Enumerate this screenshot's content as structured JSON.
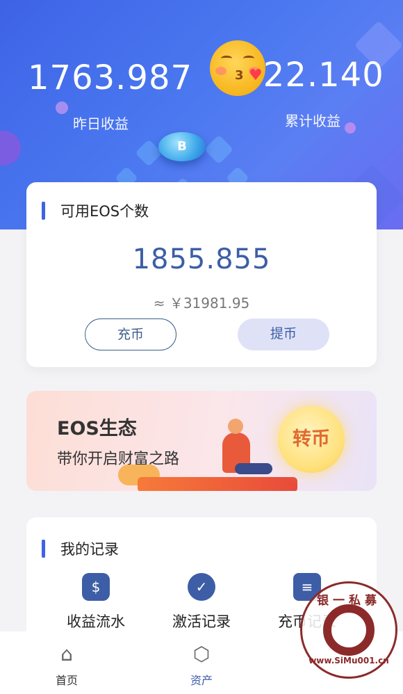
{
  "header": {
    "yesterday_value": "1763.987",
    "yesterday_label": "昨日收益",
    "total_value": "622.140",
    "total_label": "累计收益"
  },
  "eos_card": {
    "title": "可用EOS个数",
    "amount": "1855.855",
    "cny": "≈ ￥31981.95",
    "deposit_label": "充币",
    "withdraw_label": "提币"
  },
  "banner": {
    "title": "EOS生态",
    "subtitle": "带你开启财富之路",
    "button_label": "转币"
  },
  "records": {
    "title": "我的记录",
    "items": [
      {
        "label": "收益流水",
        "icon": "money-bag-icon"
      },
      {
        "label": "激活记录",
        "icon": "check-badge-icon"
      },
      {
        "label": "充币记录",
        "icon": "coins-stack-icon"
      }
    ]
  },
  "nav": {
    "items": [
      {
        "label": "首页",
        "icon": "home-icon"
      },
      {
        "label": "资产",
        "icon": "assets-icon",
        "active": true
      }
    ]
  },
  "watermark": {
    "top_text": "银一私募",
    "bottom_text": "www.SiMu001.cn"
  },
  "colors": {
    "header_blue": "#4a78f0",
    "accent": "#3d5ea6",
    "banner_button": "#e06a2e"
  }
}
